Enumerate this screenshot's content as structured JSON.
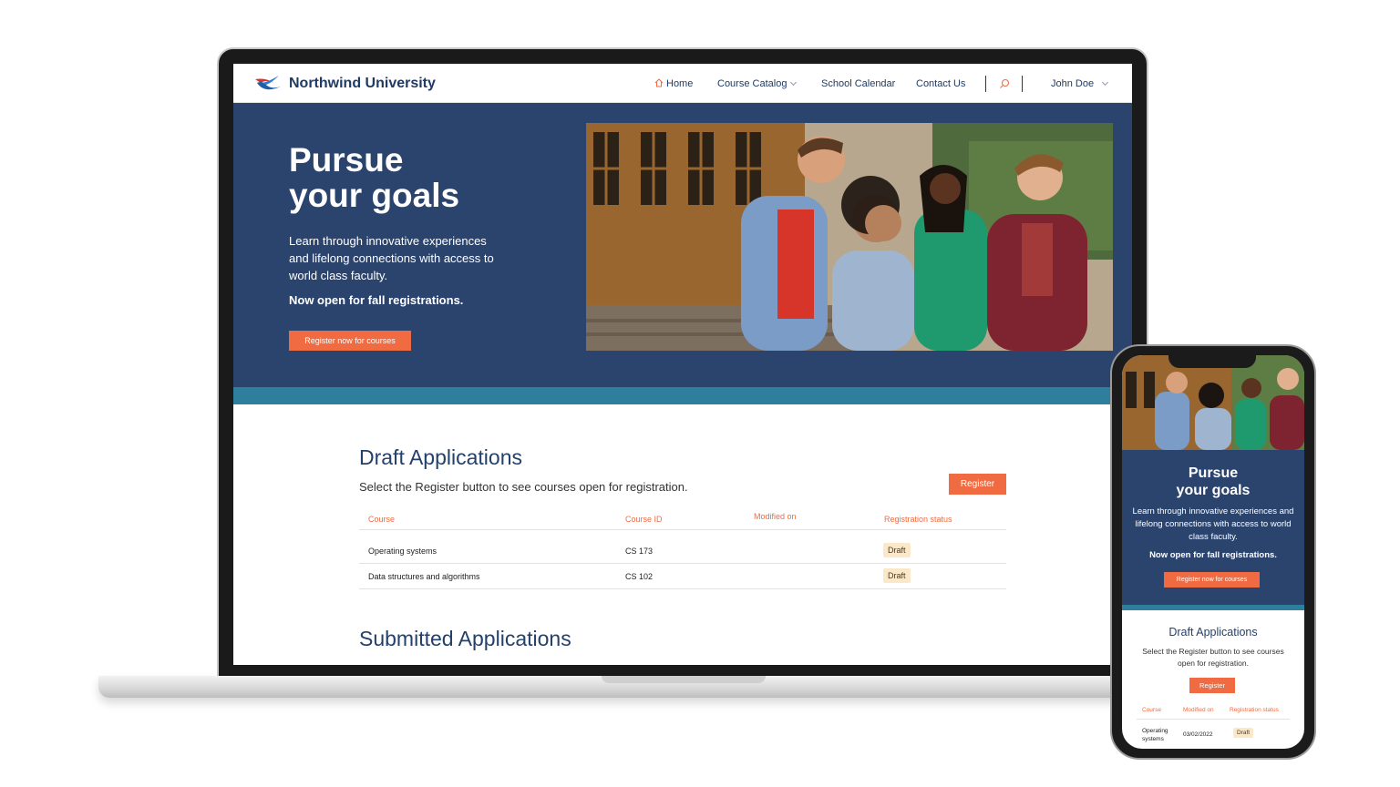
{
  "nav": {
    "brand": "Northwind University",
    "home": "Home",
    "course_catalog": "Course Catalog",
    "school_calendar": "School Calendar",
    "contact_us": "Contact Us",
    "user": "John Doe"
  },
  "hero": {
    "title_line1": "Pursue",
    "title_line2": "your goals",
    "body": "Learn through innovative experiences and lifelong connections with access to world class faculty.",
    "strong": "Now open for fall registrations.",
    "cta": "Register now for courses"
  },
  "draft": {
    "heading": "Draft Applications",
    "subtitle": "Select the Register button to see courses open for registration.",
    "register_button": "Register",
    "columns": [
      "Course",
      "Course ID",
      "Modified on",
      "Registration status"
    ],
    "rows": [
      {
        "course": "Operating systems",
        "course_id": "CS 173",
        "modified_on": "",
        "status": "Draft"
      },
      {
        "course": "Data structures and algorithms",
        "course_id": "CS 102",
        "modified_on": "",
        "status": "Draft"
      }
    ]
  },
  "submitted": {
    "heading": "Submitted Applications"
  },
  "mobile": {
    "title_line1": "Pursue",
    "title_line2": "your goals",
    "body": "Learn through innovative experiences and lifelong connections with access to world class faculty.",
    "strong": "Now open for fall registrations.",
    "cta": "Register now for courses",
    "draft_heading": "Draft Applications",
    "draft_subtitle": "Select the Register button to see courses open for registration.",
    "register_button": "Register",
    "columns": [
      "Course",
      "Modified on",
      "Registration status"
    ],
    "row": {
      "course_line1": "Operating",
      "course_line2": "systems",
      "modified_on": "03/02/2022",
      "status": "Draft"
    }
  },
  "colors": {
    "navy": "#2b446e",
    "teal": "#2d7f9d",
    "orange": "#f06b41",
    "badge": "#fbe8c9",
    "heading_blue": "#24416b"
  }
}
